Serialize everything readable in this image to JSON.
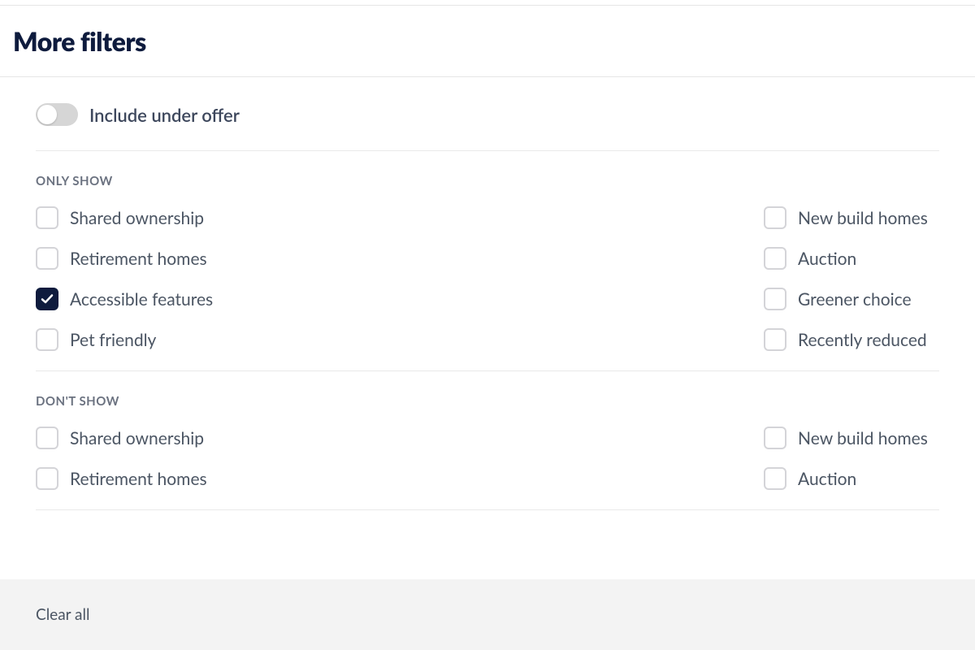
{
  "header": {
    "title": "More filters"
  },
  "toggle": {
    "label": "Include under offer",
    "checked": false
  },
  "sections": {
    "only_show": {
      "title": "ONLY SHOW",
      "items_left": [
        {
          "label": "Shared ownership",
          "checked": false
        },
        {
          "label": "Retirement homes",
          "checked": false
        },
        {
          "label": "Accessible features",
          "checked": true
        },
        {
          "label": "Pet friendly",
          "checked": false
        }
      ],
      "items_right": [
        {
          "label": "New build homes",
          "checked": false
        },
        {
          "label": "Auction",
          "checked": false
        },
        {
          "label": "Greener choice",
          "checked": false
        },
        {
          "label": "Recently reduced",
          "checked": false
        }
      ]
    },
    "dont_show": {
      "title": "DON'T SHOW",
      "items_left": [
        {
          "label": "Shared ownership",
          "checked": false
        },
        {
          "label": "Retirement homes",
          "checked": false
        }
      ],
      "items_right": [
        {
          "label": "New build homes",
          "checked": false
        },
        {
          "label": "Auction",
          "checked": false
        }
      ]
    }
  },
  "footer": {
    "clear_all": "Clear all"
  }
}
